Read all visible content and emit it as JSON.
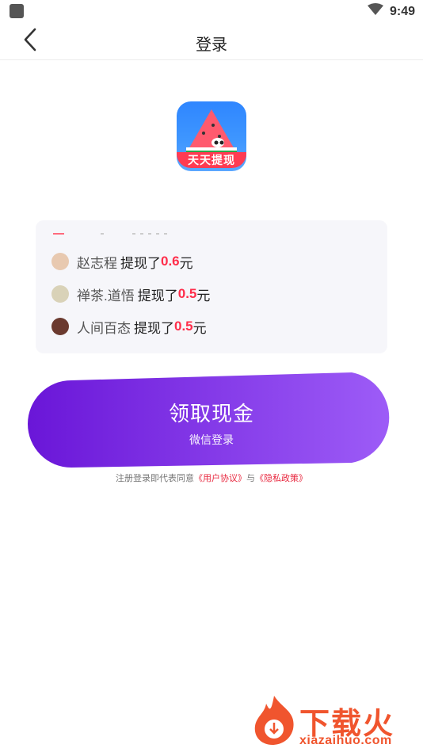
{
  "status_bar": {
    "time": "9:49"
  },
  "nav": {
    "title": "登录"
  },
  "logo": {
    "label": "天天提现"
  },
  "feed": {
    "items": [
      {
        "name": "赵志程",
        "verb": "提现了",
        "amount": "0.6",
        "unit": "元",
        "avatar_color": "#e8c9b0"
      },
      {
        "name": "禅茶.道悟",
        "verb": "提现了",
        "amount": "0.5",
        "unit": "元",
        "avatar_color": "#d9d2b8"
      },
      {
        "name": "人间百态",
        "verb": "提现了",
        "amount": "0.5",
        "unit": "元",
        "avatar_color": "#6b3a2f"
      }
    ]
  },
  "cta": {
    "title": "领取现金",
    "subtitle": "微信登录"
  },
  "agreement": {
    "prefix": "注册登录即代表同意",
    "user_agreement": "《用户协议》",
    "connector": "与",
    "privacy_policy": "《隐私政策》"
  },
  "watermark": {
    "brand": "下载火",
    "url": "xiazaihuo.com"
  },
  "colors": {
    "accent_red": "#ff2d4a",
    "cta_start": "#6a16d8",
    "cta_end": "#9d5cf7",
    "watermark": "#f0552e"
  }
}
